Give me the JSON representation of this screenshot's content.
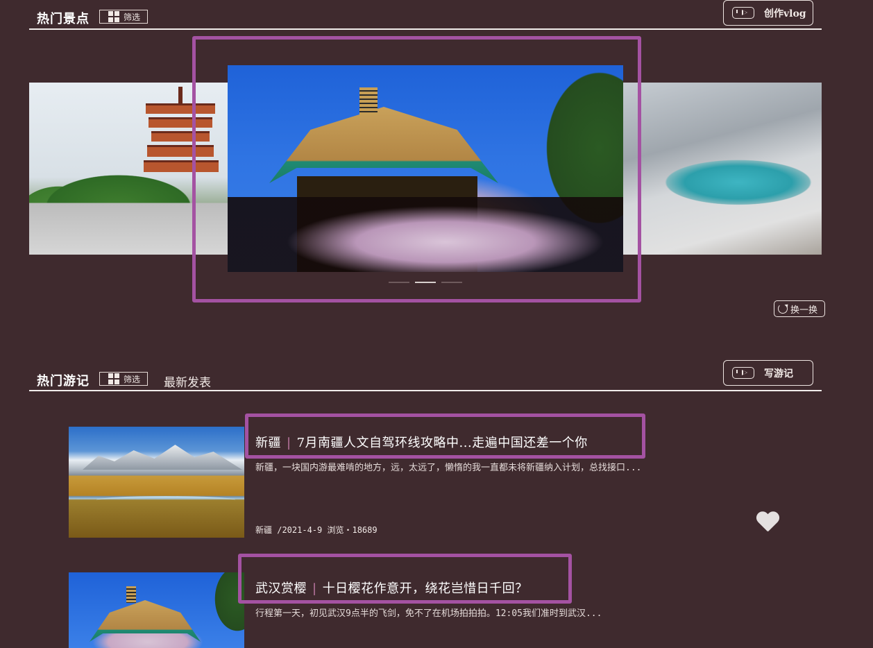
{
  "hot_spots": {
    "title": "热门景点",
    "filter_label": "筛选",
    "create_vlog_label": "创作vlog",
    "refresh_label": "换一换",
    "carousel": {
      "slides": [
        {
          "name": "yellow-crane-tower-icon"
        },
        {
          "name": "cherry-blossom-pavilion-icon"
        },
        {
          "name": "snow-lake-icon"
        }
      ],
      "active_index": 1,
      "dot_count": 3
    }
  },
  "hot_notes": {
    "title": "热门游记",
    "filter_label": "筛选",
    "latest_tab": "最新发表",
    "write_label": "写游记",
    "articles": [
      {
        "region": "新疆",
        "title": "7月南疆人文自驾环线攻略中...走遍中国还差一个你",
        "summary": "新疆，一块国内游最难啃的地方，远，太远了，懒惰的我一直都未将新疆纳入计划，总找接口...",
        "meta": "新疆 /2021-4-9 浏览・18689"
      },
      {
        "region": "武汉赏樱",
        "title": "十日樱花作意开，绕花岂惜日千回？",
        "summary": "行程第一天，初见武汉9点半的飞剑，免不了在机场拍拍拍。12:05我们准时到武汉..."
      }
    ],
    "separator": "|"
  },
  "colors": {
    "background": "#3f2a2e",
    "highlight": "#a452a2",
    "text": "#f1e9e6"
  }
}
